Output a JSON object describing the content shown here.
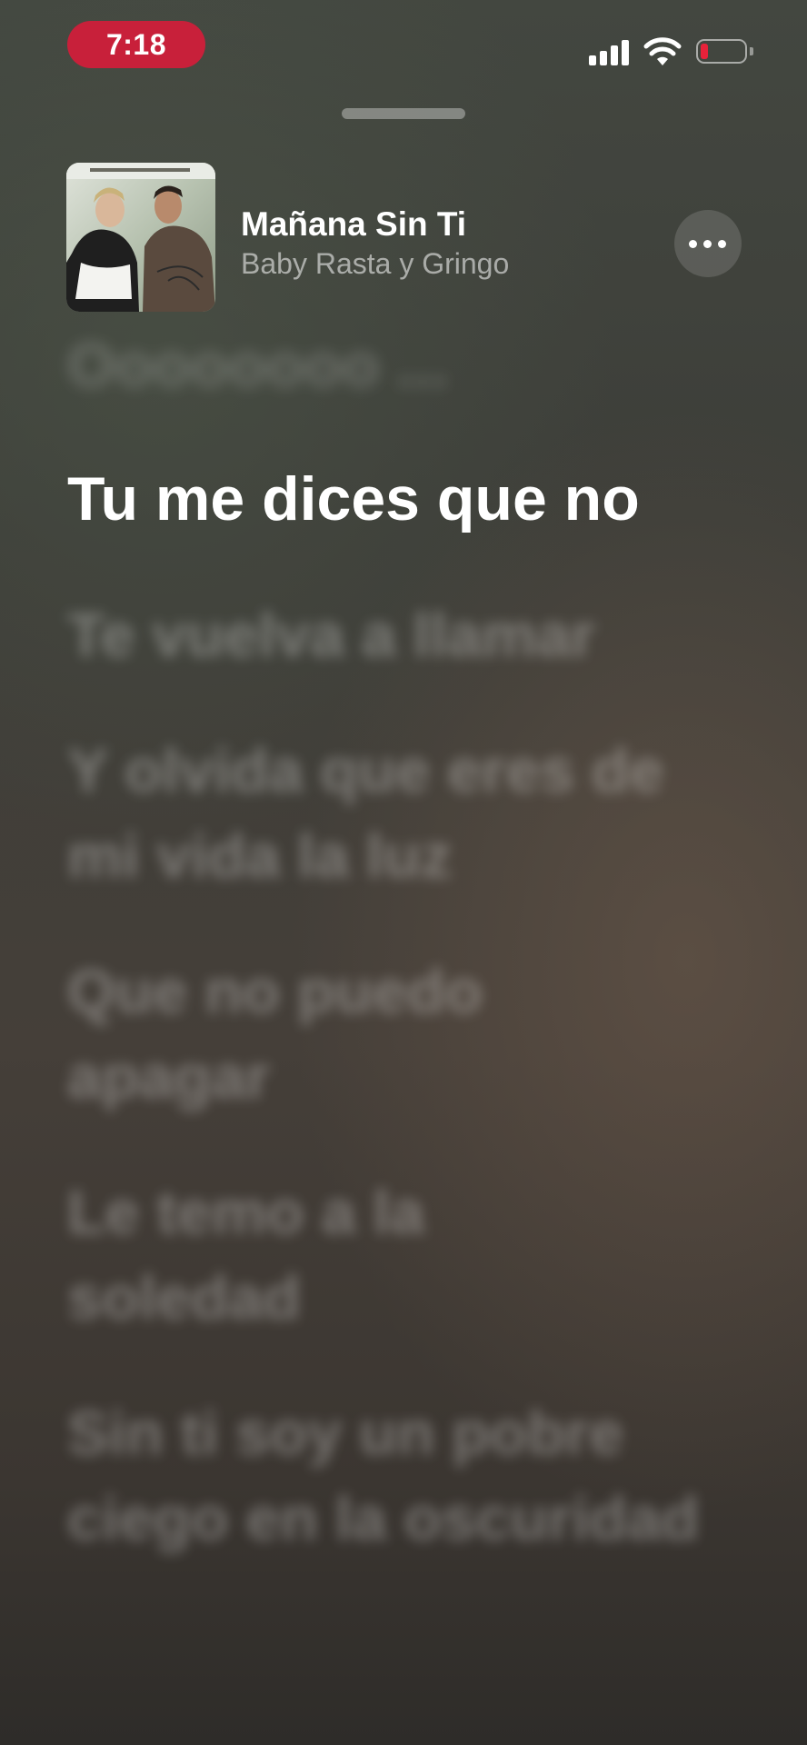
{
  "status_bar": {
    "time": "7:18",
    "icons": [
      "cellular-signal-icon",
      "wifi-icon",
      "battery-low-icon"
    ],
    "recording_color": "#c8203a",
    "battery_color": "#e8223a"
  },
  "now_playing": {
    "title": "Mañana Sin Ti",
    "artist": "Baby Rasta y Gringo",
    "more_icon": "ellipsis-icon"
  },
  "lyrics": {
    "previous": "Oooooooo ...",
    "current": "Tu me dices que no",
    "upcoming": [
      "Te vuelva a llamar",
      "Y olvida que eres de mi vida la luz",
      "Que no puedo apagar",
      "Le temo a la soledad",
      "Sin ti soy un pobre ciego en la oscuridad"
    ]
  }
}
